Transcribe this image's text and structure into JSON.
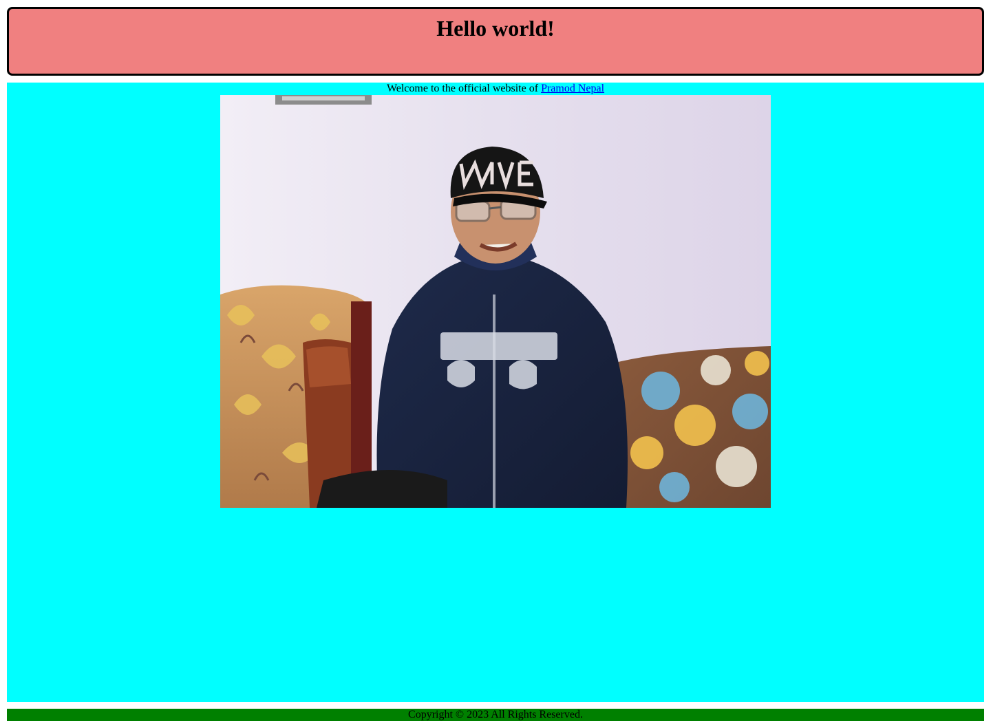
{
  "header": {
    "title": "Hello world!"
  },
  "main": {
    "welcome_text": "Welcome to the official website of ",
    "link_text": "Pramod Nepal"
  },
  "footer": {
    "copyright": "Copyright © 2023 All Rights Reserved."
  },
  "colors": {
    "header_bg": "#f08080",
    "main_bg": "#00ffff",
    "footer_bg": "#008000",
    "link": "#0000ee"
  }
}
